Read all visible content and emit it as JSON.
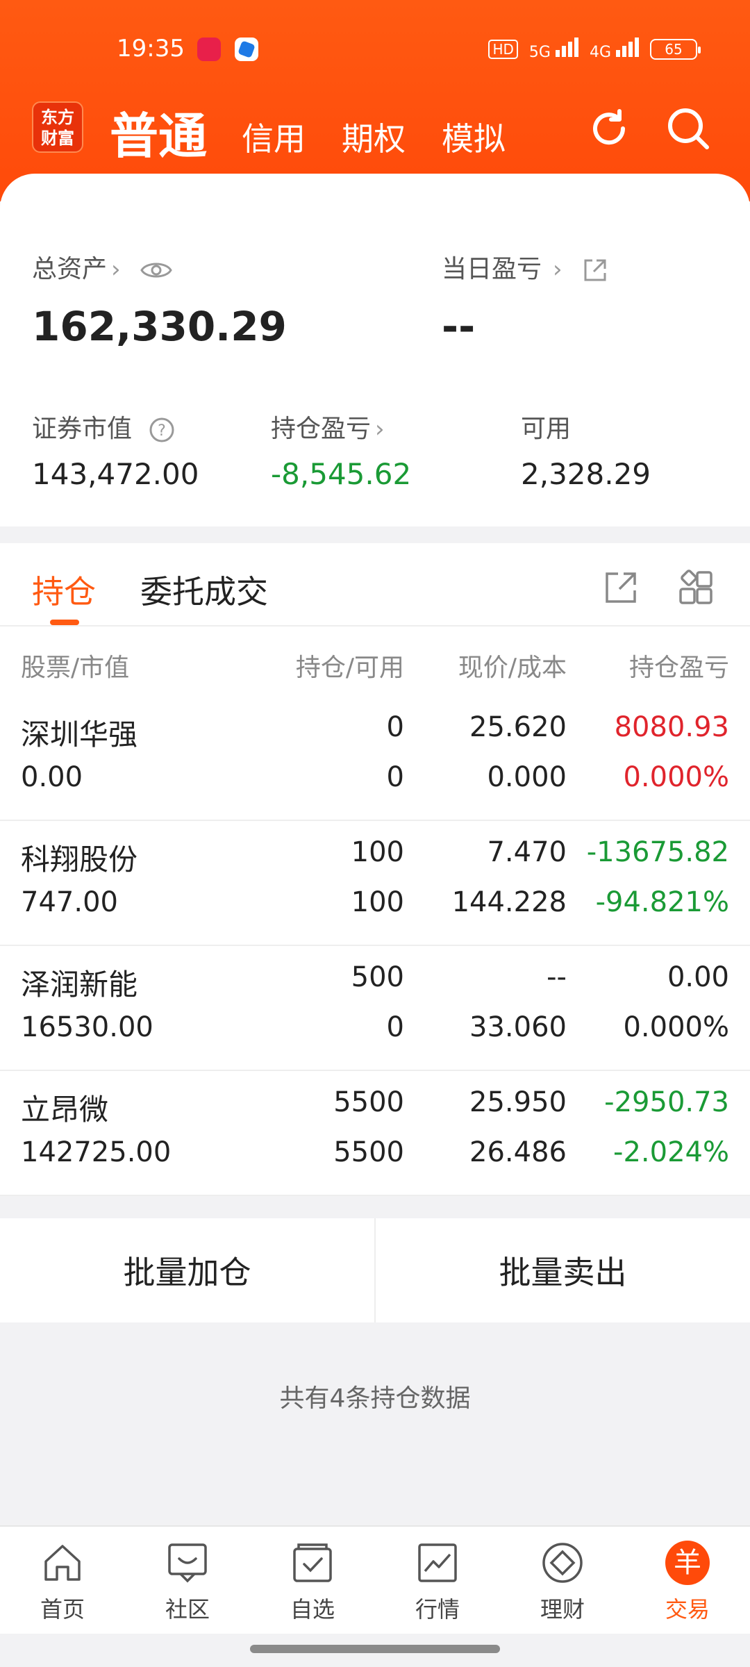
{
  "status_bar": {
    "time": "19:35",
    "hd": "HD",
    "net1": "5G",
    "net2": "4G",
    "battery": "65"
  },
  "header": {
    "logo_line1": "东方",
    "logo_line2": "财富",
    "tabs": [
      "普通",
      "信用",
      "期权",
      "模拟"
    ]
  },
  "assets": {
    "total_label": "总资产",
    "total_value": "162,330.29",
    "daily_pl_label": "当日盈亏",
    "daily_pl_value": "--",
    "market_value_label": "证券市值",
    "market_value": "143,472.00",
    "position_pl_label": "持仓盈亏",
    "position_pl": "-8,545.62",
    "available_label": "可用",
    "available": "2,328.29"
  },
  "holdings": {
    "tabs": [
      "持仓",
      "委托成交"
    ],
    "columns": [
      "股票/市值",
      "持仓/可用",
      "现价/成本",
      "持仓盈亏"
    ],
    "rows": [
      {
        "name": "深圳华强",
        "mval": "0.00",
        "pos": "0",
        "avail": "0",
        "price": "25.620",
        "cost": "0.000",
        "pl": "8080.93",
        "plpct": "0.000%",
        "color": "red"
      },
      {
        "name": "科翔股份",
        "mval": "747.00",
        "pos": "100",
        "avail": "100",
        "price": "7.470",
        "cost": "144.228",
        "pl": "-13675.82",
        "plpct": "-94.821%",
        "color": "green"
      },
      {
        "name": "泽润新能",
        "mval": "16530.00",
        "pos": "500",
        "avail": "0",
        "price": "--",
        "cost": "33.060",
        "pl": "0.00",
        "plpct": "0.000%",
        "color": "neutral"
      },
      {
        "name": "立昂微",
        "mval": "142725.00",
        "pos": "5500",
        "avail": "5500",
        "price": "25.950",
        "cost": "26.486",
        "pl": "-2950.73",
        "plpct": "-2.024%",
        "color": "green"
      }
    ]
  },
  "actions": {
    "batch_add": "批量加仓",
    "batch_sell": "批量卖出"
  },
  "footnote": "共有4条持仓数据",
  "bottom_nav": [
    {
      "label": "首页",
      "icon": "home-icon"
    },
    {
      "label": "社区",
      "icon": "community-icon"
    },
    {
      "label": "自选",
      "icon": "watchlist-icon"
    },
    {
      "label": "行情",
      "icon": "market-icon"
    },
    {
      "label": "理财",
      "icon": "wealth-icon"
    },
    {
      "label": "交易",
      "icon": "trade-icon",
      "glyph": "羊"
    }
  ],
  "colors": {
    "accent": "#ff5a12",
    "gain": "#e0242c",
    "loss": "#1a9a35"
  }
}
